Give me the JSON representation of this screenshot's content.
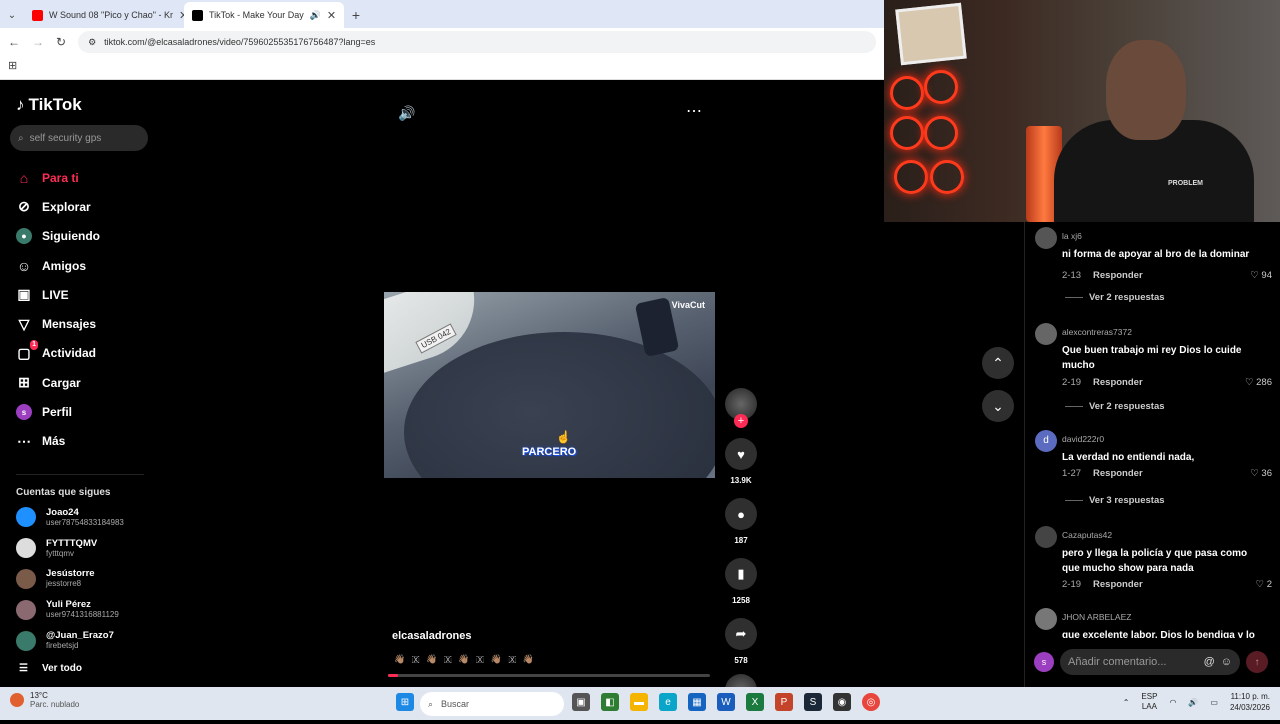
{
  "browser": {
    "tabs": [
      {
        "title": "W Sound 08 \"Pico y Chao\" - Kr",
        "icon": "youtube-icon",
        "color": "#ff0000"
      },
      {
        "title": "TikTok - Make Your Day",
        "icon": "tiktok-icon",
        "color": "#000000"
      }
    ],
    "url": "tiktok.com/@elcasaladrones/video/7596025535176756487?lang=es"
  },
  "tiktok": {
    "brand": "TikTok",
    "search_placeholder": "self security gps",
    "nav": [
      {
        "label": "Para ti",
        "icon": "home-icon"
      },
      {
        "label": "Explorar",
        "icon": "compass-icon"
      },
      {
        "label": "Siguiendo",
        "icon": "following-icon"
      },
      {
        "label": "Amigos",
        "icon": "friends-icon"
      },
      {
        "label": "LIVE",
        "icon": "live-icon"
      },
      {
        "label": "Mensajes",
        "icon": "messages-icon"
      },
      {
        "label": "Actividad",
        "icon": "activity-icon",
        "badge": "1"
      },
      {
        "label": "Cargar",
        "icon": "upload-icon"
      },
      {
        "label": "Perfil",
        "icon": "profile-icon",
        "avatar": "s"
      },
      {
        "label": "Más",
        "icon": "more-icon"
      }
    ],
    "following_title": "Cuentas que sigues",
    "following": [
      {
        "name": "Joao24",
        "user": "user78754833184983",
        "color": "#1e90ff"
      },
      {
        "name": "FYTTTQMV",
        "user": "fytttqmv",
        "color": "#dddddd"
      },
      {
        "name": "Jesústorre",
        "user": "jesstorre8",
        "color": "#7a5a48"
      },
      {
        "name": "Yuli Pérez",
        "user": "user9741316881129",
        "color": "#8a6a70"
      },
      {
        "name": "@Juan_Erazo7",
        "user": "firebetsjd",
        "color": "#3a7a6a"
      }
    ],
    "see_all": "Ver todo"
  },
  "video": {
    "watermark": "VivaCut",
    "caption": "PARCERO",
    "plate": "USB 042",
    "author": "elcasaladrones",
    "description_emojis": "👋🏽 🇽 👋🏽 🇽 👋🏽 🇽 👋🏽 🇽 👋🏽",
    "progress": 0.03,
    "likes": "13.9K",
    "comments": "187",
    "saves": "1258",
    "shares": "578"
  },
  "comments": [
    {
      "user": "la xj6",
      "text": "ni forma de apoyar al bro de la dominar",
      "date": "2-13",
      "reply": "Responder",
      "likes": "94",
      "replies": "Ver 2 respuestas",
      "avatar_color": "#555555"
    },
    {
      "user": "alexcontreras7372",
      "text": "Que buen trabajo mi rey Dios lo cuide mucho",
      "date": "2-19",
      "reply": "Responder",
      "likes": "286",
      "replies": "Ver 2 respuestas",
      "avatar_color": "#666666"
    },
    {
      "user": "david222r0",
      "text": "La verdad no entiendi nada,",
      "date": "1-27",
      "reply": "Responder",
      "likes": "36",
      "replies": "Ver 3 respuestas",
      "avatar_color": "#5b6bc0",
      "avatar_letter": "d"
    },
    {
      "user": "Cazaputas42",
      "text": "pero y llega la policía y que pasa como que mucho show para nada",
      "date": "2-19",
      "reply": "Responder",
      "likes": "2",
      "avatar_color": "#444444"
    },
    {
      "user": "JHON ARBELAEZ",
      "text": "que excelente labor, Dios lo bendiga y lo",
      "avatar_color": "#777777"
    }
  ],
  "comment_input": {
    "placeholder": "Añadir comentario...",
    "avatar": "s"
  },
  "taskbar": {
    "temp": "13°C",
    "weather": "Parc. nublado",
    "search": "Buscar",
    "lang": "ESP\nLAA",
    "lang1": "ESP",
    "lang2": "LAA",
    "time": "11:10 p. m.",
    "date": "24/03/2026"
  },
  "webcam": {
    "shirt_text": "PROBLEM"
  }
}
